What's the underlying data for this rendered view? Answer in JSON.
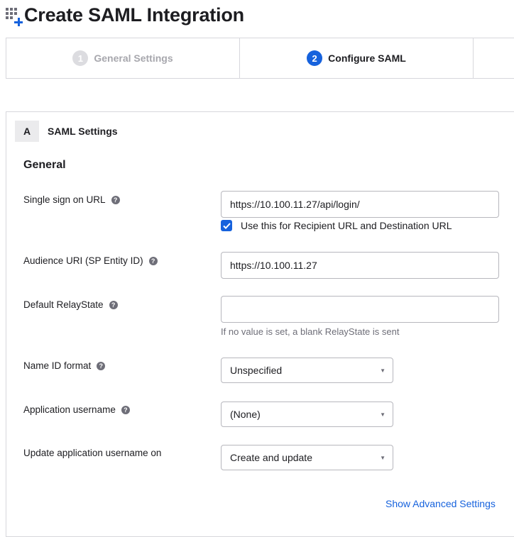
{
  "header": {
    "title": "Create SAML Integration",
    "icon": "app-grid-plus-icon"
  },
  "steps": [
    {
      "number": "1",
      "label": "General Settings",
      "state": "inactive"
    },
    {
      "number": "2",
      "label": "Configure SAML",
      "state": "active"
    },
    {
      "number": "",
      "label": "",
      "state": "inactive"
    }
  ],
  "section": {
    "letter": "A",
    "title": "SAML Settings",
    "group_title": "General"
  },
  "fields": {
    "sso_url": {
      "label": "Single sign on URL",
      "value": "https://10.100.11.27/api/login/",
      "checkbox_label": "Use this for Recipient URL and Destination URL",
      "checkbox_checked": true
    },
    "audience_uri": {
      "label": "Audience URI (SP Entity ID)",
      "value": "https://10.100.11.27"
    },
    "relay_state": {
      "label": "Default RelayState",
      "value": "",
      "hint": "If no value is set, a blank RelayState is sent"
    },
    "name_id_format": {
      "label": "Name ID format",
      "value": "Unspecified"
    },
    "app_username": {
      "label": "Application username",
      "value": "(None)"
    },
    "update_username_on": {
      "label": "Update application username on",
      "value": "Create and update"
    }
  },
  "links": {
    "advanced": "Show Advanced Settings"
  },
  "colors": {
    "accent": "#1662dd",
    "border": "#d7d7dc",
    "muted_text": "#6e6e78"
  }
}
